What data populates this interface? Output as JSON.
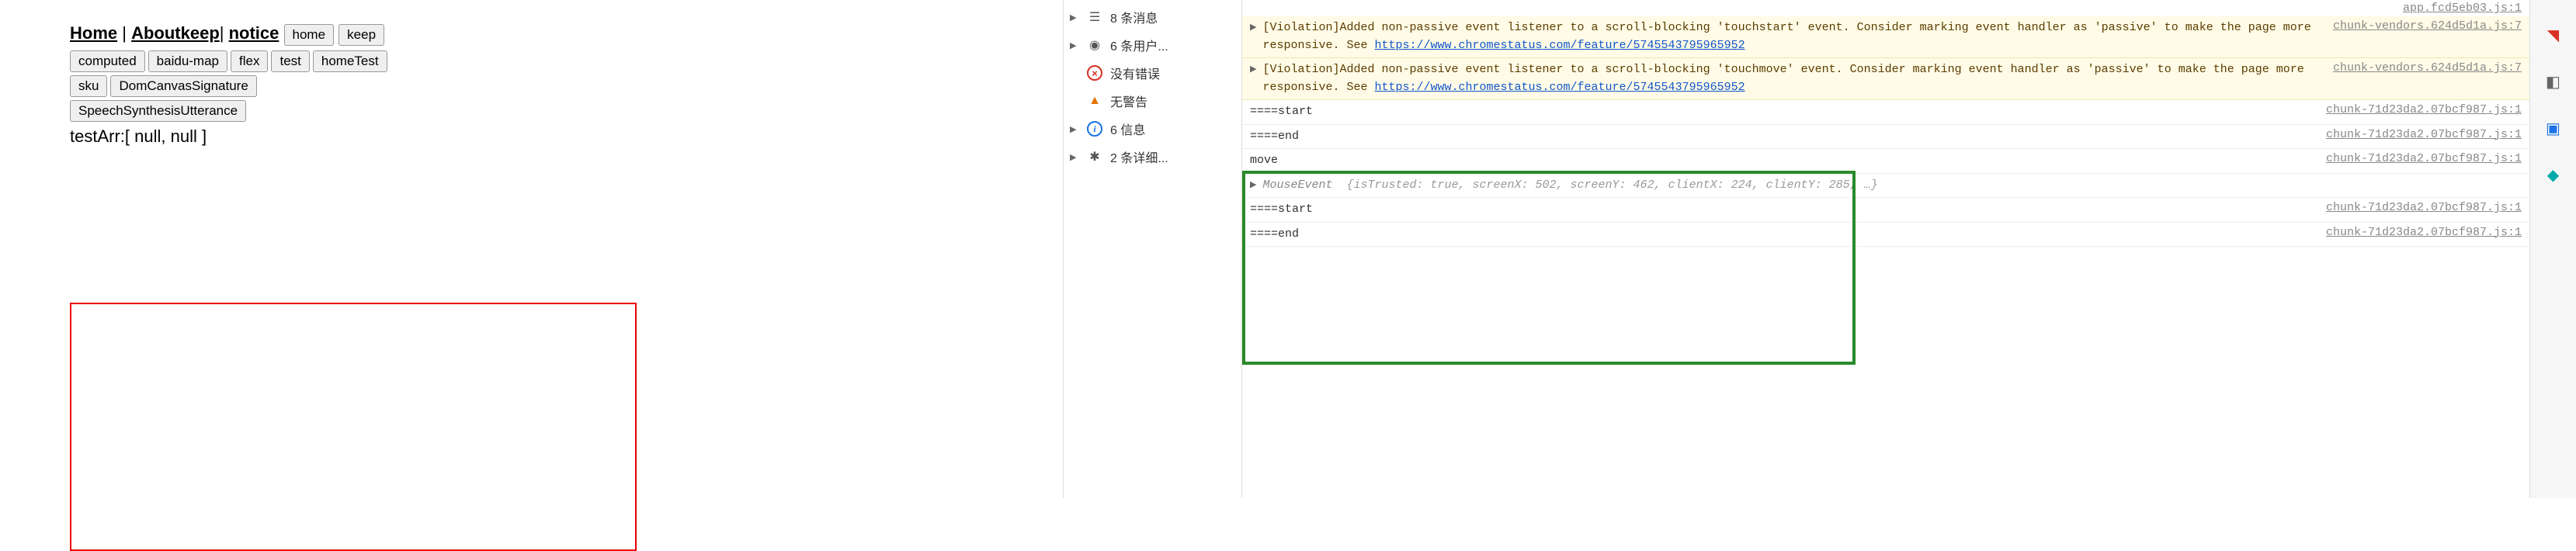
{
  "nav": {
    "home": "Home",
    "about": "Aboutkeep",
    "notice": "notice",
    "sep1": " | ",
    "sep2": "| "
  },
  "buttons": {
    "row1": [
      "home",
      "keep"
    ],
    "row2": [
      "computed",
      "baidu-map",
      "flex",
      "test",
      "homeTest"
    ],
    "row3": [
      "sku",
      "DomCanvasSignature"
    ],
    "row4": [
      "SpeechSynthesisUtterance"
    ]
  },
  "testArr": "testArr:[ null, null ]",
  "filters": {
    "messages": "8 条消息",
    "users": "6 条用户...",
    "errors": "没有错误",
    "warnings": "无警告",
    "info": "6 信息",
    "verbose": "2 条详细..."
  },
  "topSource": "app.fcd5eb03.js:1",
  "violations": [
    {
      "prefix": "[Violation]",
      "text1": "Added non-passive event listener to a scroll-blocking '",
      "event": "touchstart",
      "text2": "' event. Consider marking event handler as 'passive' to make the page more responsive. See ",
      "url": "https://www.chromestatus.com/feature/5745543795965952",
      "source": "chunk-vendors.624d5d1a.js:7"
    },
    {
      "prefix": "[Violation]",
      "text1": "Added non-passive event listener to a scroll-blocking '",
      "event": "touchmove",
      "text2": "' event. Consider marking event handler as 'passive' to make the page more responsive. See ",
      "url": "https://www.chromestatus.com/feature/5745543795965952",
      "source": "chunk-vendors.624d5d1a.js:7"
    }
  ],
  "logs": [
    {
      "text": "====start",
      "source": "chunk-71d23da2.07bcf987.js:1"
    },
    {
      "text": "====end",
      "source": "chunk-71d23da2.07bcf987.js:1"
    },
    {
      "text": "move",
      "source": "chunk-71d23da2.07bcf987.js:1"
    },
    {
      "type": "mouseevent",
      "label": "MouseEvent",
      "props": "{isTrusted: true, screenX: 502, screenY: 462, clientX: 224, clientY: 285,  …}",
      "source": ""
    },
    {
      "text": "====start",
      "source": "chunk-71d23da2.07bcf987.js:1"
    },
    {
      "text": "====end",
      "source": "chunk-71d23da2.07bcf987.js:1"
    }
  ]
}
